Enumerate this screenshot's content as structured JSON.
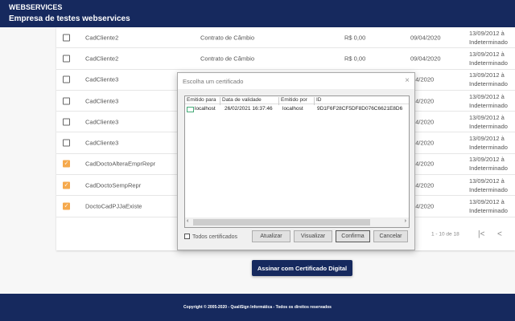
{
  "header": {
    "title": "WEBSERVICES",
    "company": "Empresa de testes webservices"
  },
  "rows": [
    {
      "name": "CadCliente2",
      "type": "Contrato de Câmbio",
      "value": "R$ 0,00",
      "date": "09/04/2020",
      "vig1": "13/09/2012 à",
      "vig2": "Indeterminado",
      "checked": false
    },
    {
      "name": "CadCliente2",
      "type": "Contrato de Câmbio",
      "value": "R$ 0,00",
      "date": "09/04/2020",
      "vig1": "13/09/2012 à",
      "vig2": "Indeterminado",
      "checked": false
    },
    {
      "name": "CadCliente3",
      "date": "/04/2020",
      "vig1": "13/09/2012 à",
      "vig2": "Indeterminado",
      "checked": false
    },
    {
      "name": "CadCliente3",
      "date": "/04/2020",
      "vig1": "13/09/2012 à",
      "vig2": "Indeterminado",
      "checked": false
    },
    {
      "name": "CadCliente3",
      "date": "/04/2020",
      "vig1": "13/09/2012 à",
      "vig2": "Indeterminado",
      "checked": false
    },
    {
      "name": "CadCliente3",
      "date": "/04/2020",
      "vig1": "13/09/2012 à",
      "vig2": "Indeterminado",
      "checked": false
    },
    {
      "name": "CadDoctoAlteraEmprRepr",
      "date": "/04/2020",
      "vig1": "13/09/2012 à",
      "vig2": "Indeterminado",
      "checked": true
    },
    {
      "name": "CadDoctoSempRepr",
      "date": "/04/2020",
      "vig1": "13/09/2012 à",
      "vig2": "Indeterminado",
      "checked": true
    },
    {
      "name": "DoctoCadPJJaExiste",
      "date": "/04/2020",
      "vig1": "13/09/2012 à",
      "vig2": "Indeterminado",
      "checked": true
    }
  ],
  "pagination": {
    "range": "1 - 10 de 18",
    "first": "|<",
    "prev": "<"
  },
  "sign_button": "Assinar com Certificado Digital",
  "footer": "Copyright © 2005-2020 - QualiSign Informática - Todos os direitos reservados",
  "dialog": {
    "title": "Escolha um certificado",
    "close": "×",
    "columns": [
      "Emitido para",
      "Data de validade",
      "Emitido por",
      "ID"
    ],
    "cert": {
      "to": "localhost",
      "valid": "26/02/2021 16:37:46",
      "by": "localhost",
      "id": "9D1F6F28CF5DF8D076C6621E8D6"
    },
    "all_certs": "Todos certificados",
    "buttons": {
      "refresh": "Atualizar",
      "view": "Visualizar",
      "confirm": "Confirma",
      "cancel": "Cancelar"
    }
  }
}
